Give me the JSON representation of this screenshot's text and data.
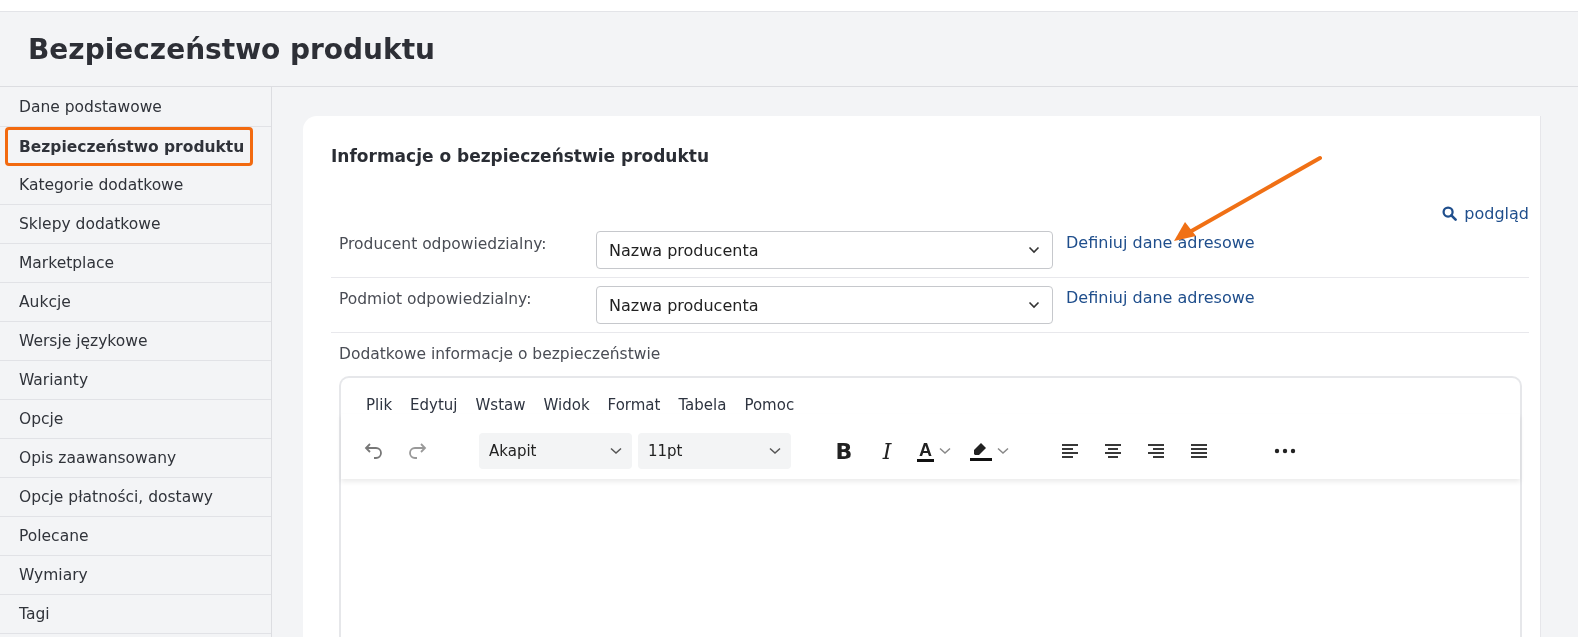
{
  "page_title": "Bezpieczeństwo produktu",
  "sidebar": {
    "items": [
      {
        "label": "Dane podstawowe",
        "selected": false
      },
      {
        "label": "Bezpieczeństwo produktu",
        "selected": true
      },
      {
        "label": "Kategorie dodatkowe",
        "selected": false
      },
      {
        "label": "Sklepy dodatkowe",
        "selected": false
      },
      {
        "label": "Marketplace",
        "selected": false
      },
      {
        "label": "Aukcje",
        "selected": false
      },
      {
        "label": "Wersje językowe",
        "selected": false
      },
      {
        "label": "Warianty",
        "selected": false
      },
      {
        "label": "Opcje",
        "selected": false
      },
      {
        "label": "Opis zaawansowany",
        "selected": false
      },
      {
        "label": "Opcje płatności, dostawy",
        "selected": false
      },
      {
        "label": "Polecane",
        "selected": false
      },
      {
        "label": "Wymiary",
        "selected": false
      },
      {
        "label": "Tagi",
        "selected": false
      }
    ]
  },
  "card": {
    "title": "Informacje o bezpieczeństwie produktu",
    "preview_link": "podgląd",
    "fields": [
      {
        "label": "Producent odpowiedzialny:",
        "value": "Nazwa producenta",
        "link": "Definiuj dane adresowe"
      },
      {
        "label": "Podmiot odpowiedzialny:",
        "value": "Nazwa producenta",
        "link": "Definiuj dane adresowe"
      }
    ],
    "editor_label": "Dodatkowe informacje o bezpieczeństwie",
    "editor": {
      "menu": [
        "Plik",
        "Edytuj",
        "Wstaw",
        "Widok",
        "Format",
        "Tabela",
        "Pomoc"
      ],
      "toolbar": [
        {
          "kind": "undo"
        },
        {
          "kind": "redo"
        },
        {
          "kind": "select",
          "value": "Akapit"
        },
        {
          "kind": "select",
          "value": "11pt"
        },
        {
          "kind": "bold",
          "glyph": "B"
        },
        {
          "kind": "italic",
          "glyph": "I"
        },
        {
          "kind": "textcolor",
          "glyph": "A"
        },
        {
          "kind": "highlight"
        },
        {
          "kind": "align-left"
        },
        {
          "kind": "align-center"
        },
        {
          "kind": "align-right"
        },
        {
          "kind": "justify"
        },
        {
          "kind": "more"
        }
      ]
    }
  }
}
